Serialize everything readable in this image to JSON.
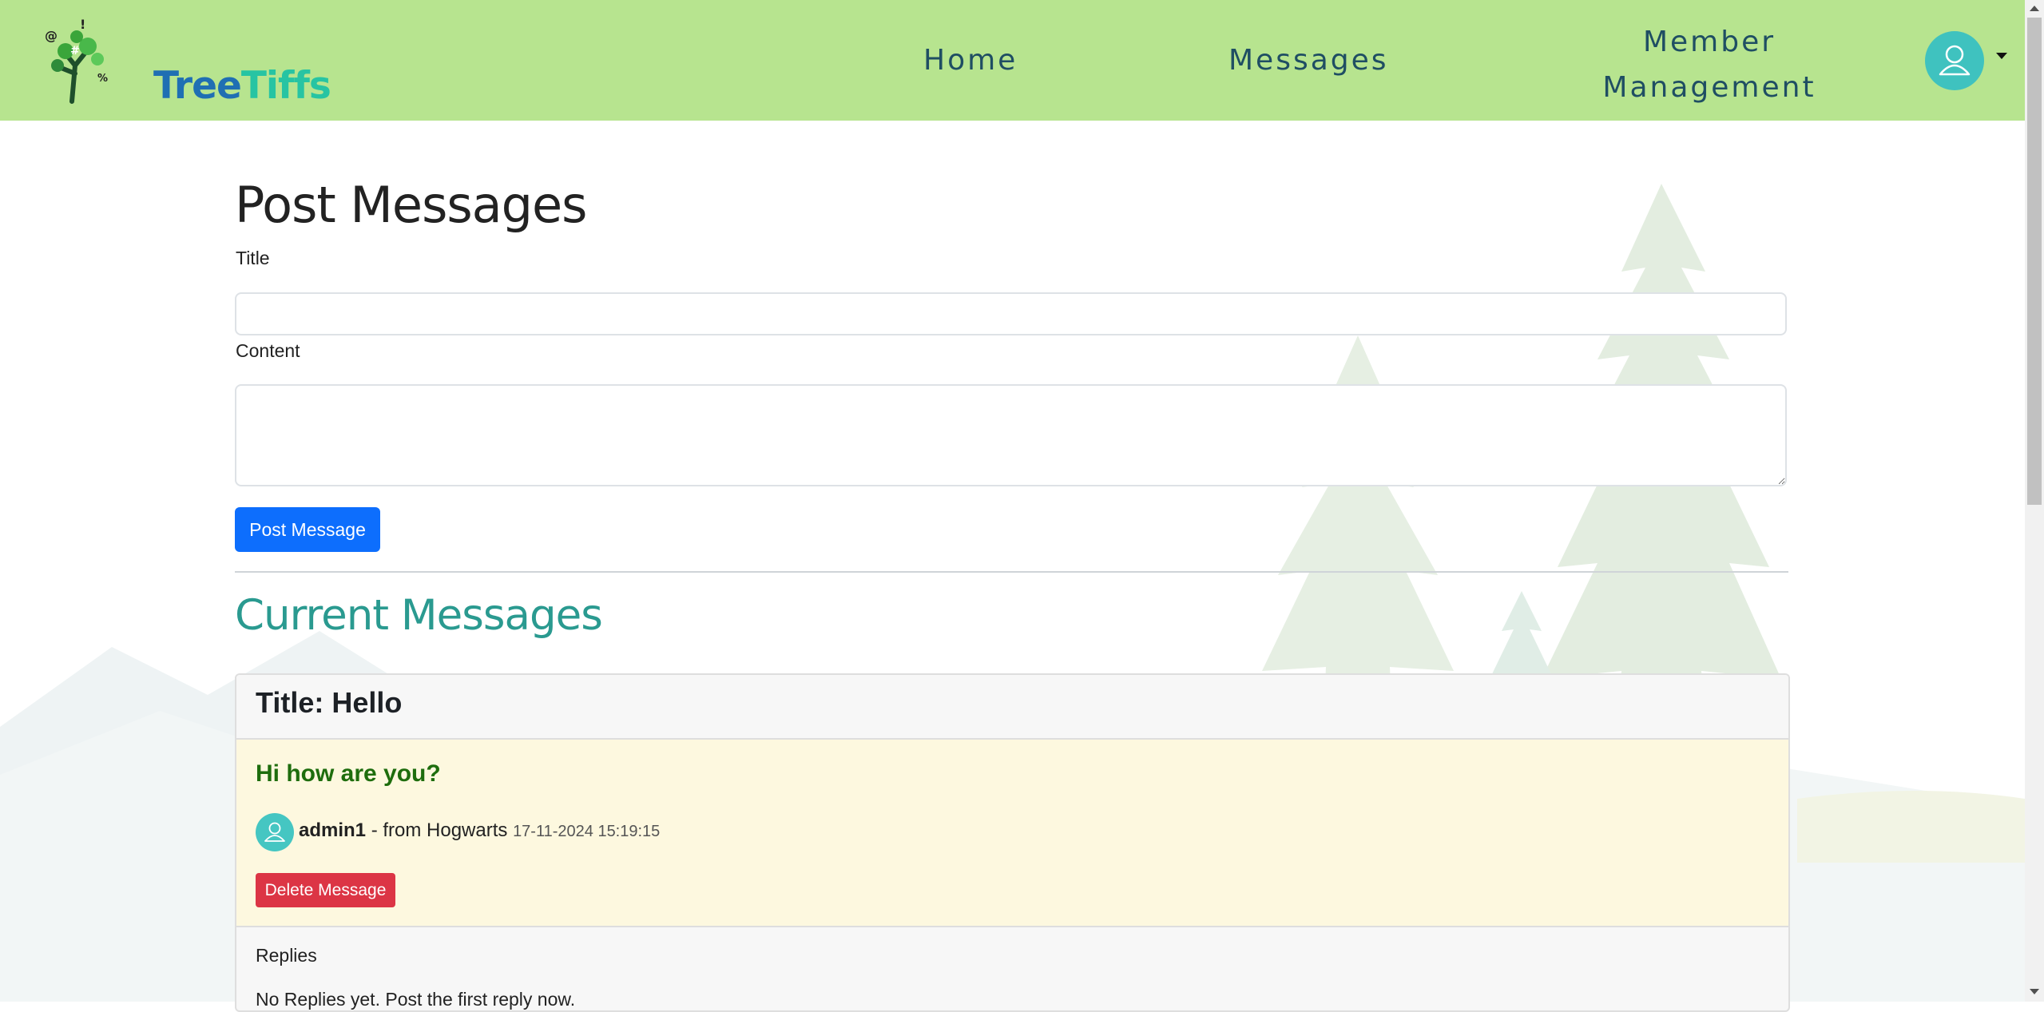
{
  "header": {
    "logo_part1": "Tree",
    "logo_part2": "Tiffs",
    "nav": {
      "home": "Home",
      "messages": "Messages",
      "members_line1": "Member",
      "members_line2": "Management"
    },
    "profile_icon": "user-icon"
  },
  "post_form": {
    "heading": "Post Messages",
    "title_label": "Title",
    "title_value": "",
    "content_label": "Content",
    "content_value": "",
    "submit_label": "Post Message"
  },
  "current_messages": {
    "heading": "Current Messages",
    "items": [
      {
        "title": "Title: Hello",
        "content": "Hi how are you?",
        "author": "admin1",
        "from": " - from Hogwarts ",
        "date": "17-11-2024 15:19:15",
        "delete_label": "Delete Message",
        "replies_label": "Replies",
        "replies_empty": "No Replies yet. Post the first reply now."
      }
    ]
  },
  "colors": {
    "navbar": "#b7e48f",
    "primary_button": "#0d6efd",
    "danger_button": "#dc3545",
    "current_heading": "#2a9a90",
    "message_text": "#1e6d0d"
  }
}
